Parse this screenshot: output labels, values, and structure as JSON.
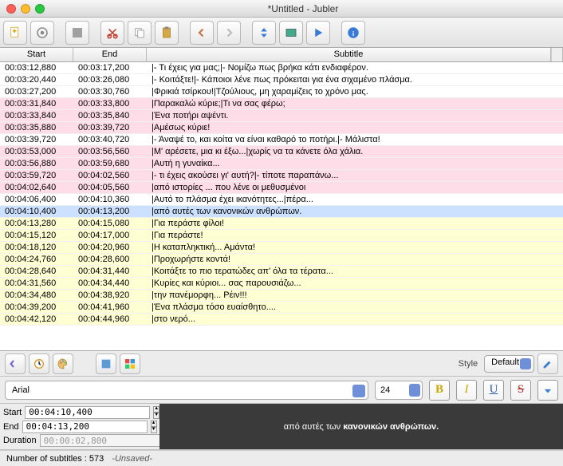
{
  "window": {
    "title": "*Untitled - Jubler"
  },
  "columns": {
    "start": "Start",
    "end": "End",
    "subtitle": "Subtitle"
  },
  "rows": [
    {
      "c": "white",
      "s": "00:03:12,880",
      "e": "00:03:17,200",
      "t": "|- Τι έχεις για μας;|- Νομίζω πως βρήκα κάτι ενδιαφέρον."
    },
    {
      "c": "white",
      "s": "00:03:20,440",
      "e": "00:03:26,080",
      "t": "|- Κοιτάξτε!|- Κάποιοι λένε πως πρόκειται για ένα σιχαμένο πλάσμα."
    },
    {
      "c": "white",
      "s": "00:03:27,200",
      "e": "00:03:30,760",
      "t": "|Φρικιά τσίρκου!|Τζούλιους, μη χαραμίζεις το χρόνο μας."
    },
    {
      "c": "pink",
      "s": "00:03:31,840",
      "e": "00:03:33,800",
      "t": "|Παρακαλώ κύριε;|Τι να σας φέρω;"
    },
    {
      "c": "pink",
      "s": "00:03:33,840",
      "e": "00:03:35,840",
      "t": "|Ένα ποτήρι αψέντι."
    },
    {
      "c": "pink",
      "s": "00:03:35,880",
      "e": "00:03:39,720",
      "t": "|Αμέσως κύριε!"
    },
    {
      "c": "white",
      "s": "00:03:39,720",
      "e": "00:03:40,720",
      "t": "|- Άναψέ το, και κοίτα να είναι καθαρό το ποτήρι.|- Μάλιστα!"
    },
    {
      "c": "pink",
      "s": "00:03:53,000",
      "e": "00:03:56,560",
      "t": "|Μ' αρέσετε, μια κι έξω...|χωρίς να τα κάνετε όλα χάλια."
    },
    {
      "c": "pink",
      "s": "00:03:56,880",
      "e": "00:03:59,680",
      "t": "|Αυτή η γυναίκα..."
    },
    {
      "c": "pink",
      "s": "00:03:59,720",
      "e": "00:04:02,560",
      "t": "|- τι έχεις ακούσει γι' αυτή?|- τίποτε παραπάνω..."
    },
    {
      "c": "pink",
      "s": "00:04:02,640",
      "e": "00:04:05,560",
      "t": "|από ιστορίες ... που λένε οι μεθυσμένοι"
    },
    {
      "c": "white",
      "s": "00:04:06,400",
      "e": "00:04:10,360",
      "t": "|Αυτό το πλάσμα έχει ικανότητες...|πέρα..."
    },
    {
      "c": "blue",
      "s": "00:04:10,400",
      "e": "00:04:13,200",
      "t": "|από αυτές των κανονικών ανθρώπων."
    },
    {
      "c": "yellow",
      "s": "00:04:13,280",
      "e": "00:04:15,080",
      "t": "|Για περάστε φίλοι!"
    },
    {
      "c": "yellow",
      "s": "00:04:15,120",
      "e": "00:04:17,000",
      "t": "|Για περάστε!"
    },
    {
      "c": "yellow",
      "s": "00:04:18,120",
      "e": "00:04:20,960",
      "t": "|Η καταπληκτική... Αμάντα!"
    },
    {
      "c": "yellow",
      "s": "00:04:24,760",
      "e": "00:04:28,600",
      "t": "|Προχωρήστε κοντά!"
    },
    {
      "c": "yellow",
      "s": "00:04:28,640",
      "e": "00:04:31,440",
      "t": "|Κοιτάξτε το πιο τερατώδες απ' όλα τα τέρατα..."
    },
    {
      "c": "yellow",
      "s": "00:04:31,560",
      "e": "00:04:34,440",
      "t": "|Κυρίες και κύριοι... σας παρουσιάζω..."
    },
    {
      "c": "yellow",
      "s": "00:04:34,480",
      "e": "00:04:38,920",
      "t": "|την πανέμορφη... Ρέιν!!!"
    },
    {
      "c": "yellow",
      "s": "00:04:39,200",
      "e": "00:04:41,960",
      "t": "|Ένα πλάσμα τόσο ευαίσθητο...."
    },
    {
      "c": "yellow",
      "s": "00:04:42,120",
      "e": "00:04:44,960",
      "t": "|στο νερό..."
    }
  ],
  "style": {
    "label": "Style",
    "value": "Default"
  },
  "font": {
    "name": "Arial",
    "size": "24"
  },
  "format": {
    "b": "B",
    "i": "I",
    "u": "U",
    "s": "S"
  },
  "timing": {
    "start_label": "Start",
    "start": "00:04:10,400",
    "end_label": "End",
    "end": "00:04:13,200",
    "dur_label": "Duration",
    "dur": "00:00:02,800"
  },
  "preview": {
    "plain": "από αυτές των ",
    "bold": "κανονικών ανθρώπων."
  },
  "status": {
    "count": "Number of subtitles : 573",
    "state": "-Unsaved-"
  }
}
